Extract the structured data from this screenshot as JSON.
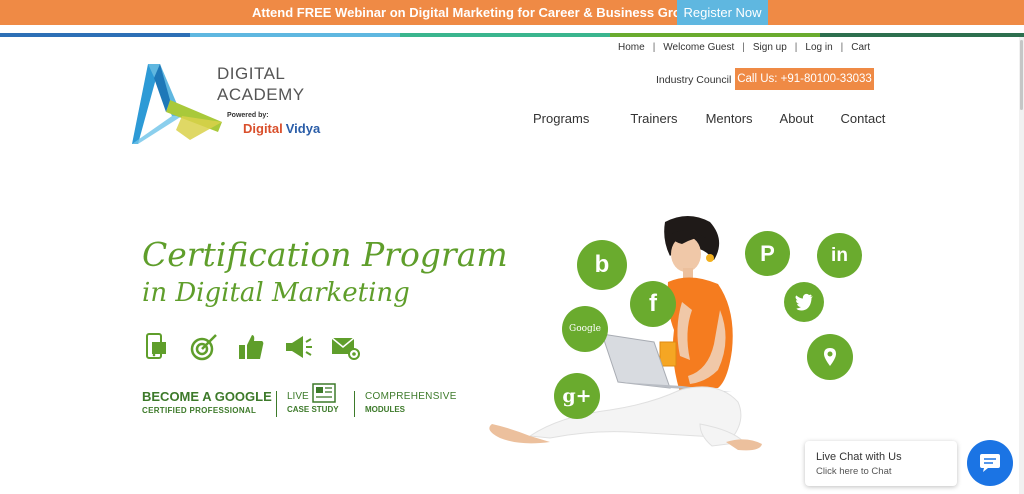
{
  "banner": {
    "text": "Attend FREE Webinar on Digital Marketing for Career & Business Growth",
    "register_label": "Register Now"
  },
  "colors": {
    "banner_orange": "#ef8a45",
    "register_blue": "#5fb7e0",
    "brand_green": "#5f9e2b",
    "social_green": "#6aab2e",
    "chat_blue": "#1b74e4"
  },
  "top_links": [
    "Home",
    "Welcome Guest",
    "Sign up",
    "Log in",
    "Cart"
  ],
  "header": {
    "industry_council": "Industry Council",
    "call_label": "Call Us: +91-80100-33033"
  },
  "logo": {
    "line1": "DIGITAL",
    "line2": "ACADEMY",
    "powered_by": "Powered by:",
    "brand_a": "Digital",
    "brand_b": "Vidya"
  },
  "nav": [
    "Programs",
    "Trainers",
    "Mentors",
    "About",
    "Contact"
  ],
  "hero": {
    "title_line1": "Certification Program",
    "title_line2": "in Digital Marketing",
    "feature_icons": [
      "mobile-icon",
      "target-icon",
      "thumbs-up-icon",
      "megaphone-icon",
      "email-icon"
    ],
    "badge1_a": "BECOME A GOOGLE",
    "badge1_b": "CERTIFIED PROFESSIONAL",
    "badge2_a": "LIVE",
    "badge2_b": "CASE STUDY",
    "badge3_a": "COMPREHENSIVE",
    "badge3_b": "MODULES"
  },
  "social_icons": [
    "bing-icon",
    "pinterest-icon",
    "linkedin-icon",
    "facebook-icon",
    "twitter-icon",
    "google-icon",
    "location-icon",
    "google-plus-icon"
  ],
  "social_labels": {
    "bing": "b",
    "pinterest": "P",
    "linkedin": "in",
    "facebook": "f",
    "google": "Google",
    "google_plus": "g+"
  },
  "chat": {
    "title": "Live Chat with Us",
    "subtitle": "Click here to Chat"
  }
}
